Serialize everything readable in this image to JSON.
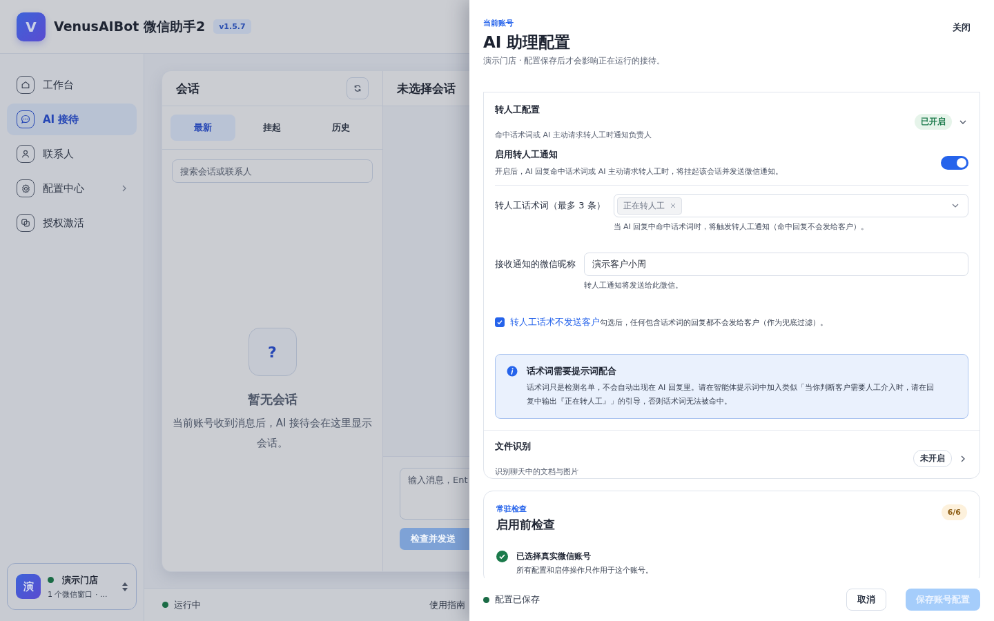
{
  "app": {
    "logo_letter": "V",
    "name": "VenusAIBot 微信助手2",
    "version": "v1.5.7"
  },
  "sidebar": {
    "items": [
      {
        "label": "工作台",
        "kind": "home",
        "selected": false,
        "has_submenu": false
      },
      {
        "label": "AI 接待",
        "kind": "chat",
        "selected": true,
        "has_submenu": false
      },
      {
        "label": "联系人",
        "kind": "person",
        "selected": false,
        "has_submenu": false
      },
      {
        "label": "配置中心",
        "kind": "gear",
        "selected": false,
        "has_submenu": true
      },
      {
        "label": "授权激活",
        "kind": "link",
        "selected": false,
        "has_submenu": false
      }
    ],
    "account": {
      "avatar": "演",
      "name": "演示门店",
      "detail": "1 个微信窗口 · ...",
      "online": true
    }
  },
  "conversations": {
    "title": "会话",
    "tabs": [
      {
        "label": "最新",
        "selected": true
      },
      {
        "label": "挂起",
        "selected": false
      },
      {
        "label": "历史",
        "selected": false
      }
    ],
    "search": {
      "placeholder": "搜索会话或联系人"
    },
    "empty": {
      "icon": "?",
      "title": "暂无会话",
      "message": "当前账号收到消息后，AI 接待会在这里显示会话。"
    }
  },
  "chat": {
    "title": "未选择会话",
    "input": {
      "placeholder": "输入消息，Ent"
    },
    "send_button": {
      "label": "检查并发送",
      "disabled": true
    }
  },
  "status_bar": {
    "status": "运行中",
    "running": true,
    "help_link": "使用指南"
  },
  "drawer": {
    "eyebrow": "当前账号",
    "title": "AI 助理配置",
    "subtitle": "演示门店 · 配置保存后才会影响正在运行的接待。",
    "close": "关闭",
    "sections": [
      {
        "title": "转人工配置",
        "description": "命中话术词或 AI 主动请求转人工时通知负责人",
        "status": "已开启",
        "enabled": true,
        "expanded": true,
        "toggle": {
          "label": "启用转人工通知",
          "description": "开启后，AI 回复命中话术词或 AI 主动请求转人工时，将挂起该会话并发送微信通知。",
          "on": true
        },
        "keywords": {
          "label": "转人工话术词（最多 3 条）",
          "tags": [
            "正在转人工"
          ],
          "hint": "当 AI 回复中命中话术词时，将触发转人工通知（命中回复不会发给客户）。"
        },
        "nickname": {
          "label": "接收通知的微信昵称",
          "value": "演示客户小周",
          "hint": "转人工通知将发送给此微信。"
        },
        "filter": {
          "checked": true,
          "label": "转人工话术不发送客户",
          "description": "勾选后，任何包含话术词的回复都不会发给客户（作为兜底过滤）。"
        },
        "notice": {
          "title": "话术词需要提示词配合",
          "text": "话术词只是检测名单，不会自动出现在 AI 回复里。请在智能体提示词中加入类似「当你判断客户需要人工介入时，请在回复中输出『正在转人工』」的引导，否则话术词无法被命中。"
        }
      },
      {
        "title": "文件识别",
        "description": "识别聊天中的文档与图片",
        "status": "未开启",
        "enabled": false,
        "expanded": false
      }
    ],
    "checks": {
      "eyebrow": "常驻检查",
      "title": "启用前检查",
      "count": "6/6",
      "items": [
        {
          "title": "已选择真实微信账号",
          "description": "所有配置和启停操作只作用于这个账号。",
          "passed": true
        }
      ]
    },
    "footer": {
      "status": "配置已保存",
      "saved": true,
      "cancel": "取消",
      "save": {
        "label": "保存账号配置",
        "disabled": true
      }
    }
  }
}
